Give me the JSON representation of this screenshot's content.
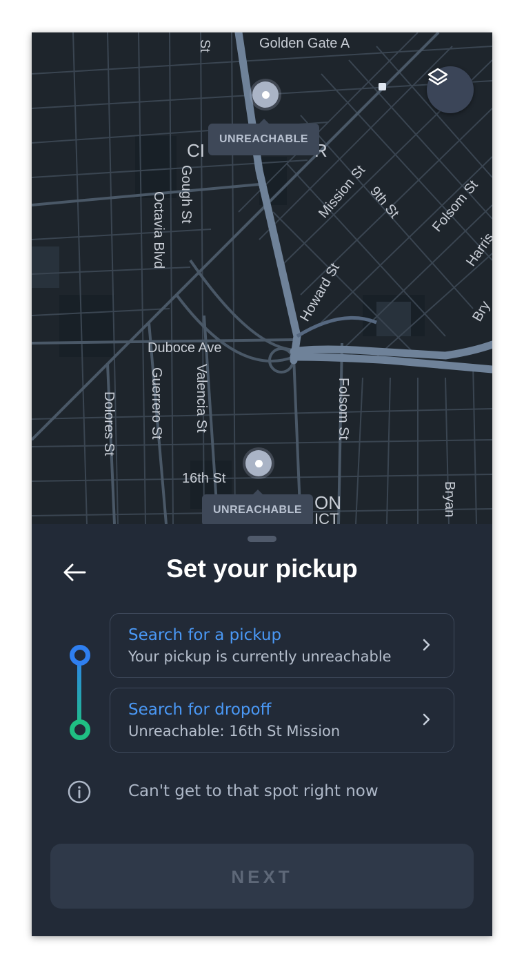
{
  "map": {
    "street_labels": {
      "golden_gate": "Golden Gate A",
      "gough": "Gough St",
      "octavia": "Octavia Blvd",
      "mission": "Mission St",
      "ninth": "9th St",
      "folsom_top": "Folsom St",
      "harrison": "Harris",
      "howard": "Howard St",
      "bryant_top": "Bry",
      "duboce": "Duboce Ave",
      "guerrero": "Guerrero St",
      "valencia": "Valencia St",
      "dolores": "Dolores St",
      "folsom": "Folsom St",
      "sixteenth": "16th St",
      "bryant": "Bryan",
      "st_top": "St",
      "civic_fragment": "CI",
      "civic_fragment_r": "R",
      "mission_fragment": "ON",
      "mission_fragment_2": "ICT"
    },
    "pins": [
      {
        "label": "UNREACHABLE"
      },
      {
        "label": "UNREACHABLE"
      }
    ],
    "layers_icon": "layers-icon"
  },
  "sheet": {
    "title": "Set your pickup",
    "back_icon": "arrow-left-icon",
    "pickup": {
      "title": "Search for a pickup",
      "subtitle": "Your pickup is currently unreachable"
    },
    "dropoff": {
      "title": "Search for dropoff",
      "subtitle": "Unreachable: 16th St Mission"
    },
    "info": {
      "icon": "info-icon",
      "text": "Can't get to that spot right now"
    },
    "next_label": "NEXT"
  },
  "colors": {
    "accent_blue": "#2f7ff0",
    "accent_green": "#1fbf83",
    "sheet_bg": "#222a37",
    "map_bg": "#1e252c"
  }
}
